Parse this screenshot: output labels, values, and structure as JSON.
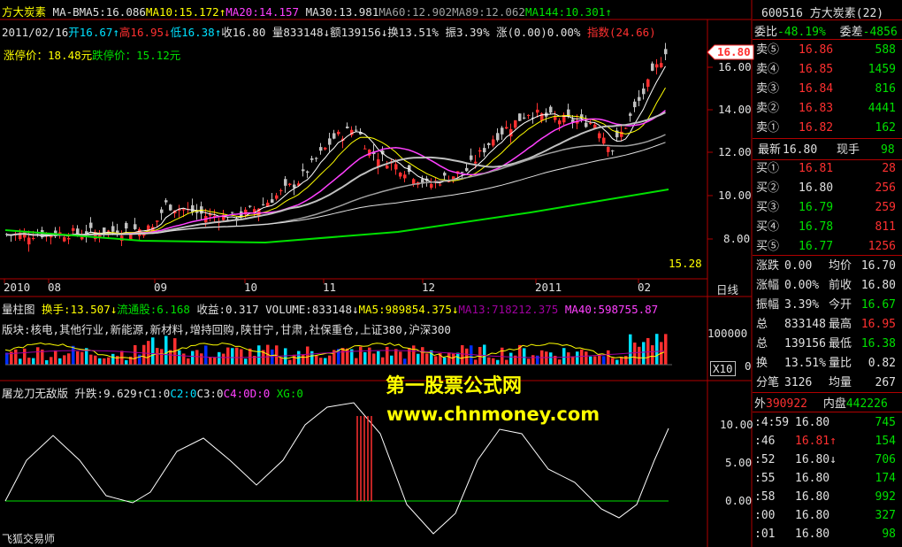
{
  "header": {
    "stock_name": "方大炭素",
    "indicator": "MA-B",
    "ma5": "MA5:16.086",
    "ma10": "MA10:15.172↑",
    "ma20": "MA20:14.157",
    "ma30": "MA30:13.981",
    "ma60": "MA60:12.902",
    "ma89": "MA89:12.062",
    "ma144": "MA144:10.301↑"
  },
  "info": {
    "date": "2011/02/16",
    "open": "开16.67↑",
    "high": "高16.95↓",
    "low": "低16.38↑",
    "close": "收16.80",
    "volume": "量833148↓",
    "amount": "额139156↓",
    "turnover": "换13.51%",
    "amplitude": "振3.39%",
    "change": "涨(0.00)0.00%",
    "index": "指数(24.66)"
  },
  "limits": {
    "up": "涨停价：18.48元",
    "down": "跌停价：15.12元"
  },
  "price_axis": [
    "16.00",
    "14.00",
    "12.00",
    "10.00",
    "8.00"
  ],
  "price_tag": "16.80",
  "low_label": "15.28",
  "time_axis": [
    "2010",
    "08",
    "09",
    "10",
    "11",
    "12",
    "2011",
    "02"
  ],
  "period_button": "日线",
  "vol_header": {
    "title": "量柱图",
    "turnover": "换手:13.507↓",
    "float": "流通股:6.168",
    "income": "收益:0.317",
    "volume": "VOLUME:833148↓",
    "ma5": "MA5:989854.375↓",
    "ma13": "MA13:718212.375",
    "ma40": "MA40:598755.87"
  },
  "sectors": "版块:核电,其他行业,新能源,新材料,增持回购,陕甘宁,甘肃,社保重仓,上证380,沪深300",
  "vol_axis": [
    "100000",
    "0"
  ],
  "vol_unit": "X10",
  "indicator_panel": {
    "title": "屠龙刀无敌版",
    "values": "升跌:9.629↑C1:0",
    "c2": "C2:0",
    "c3": "C3:0",
    "c4": "C4:0",
    "d": "D:0",
    "xg": "XG:0",
    "axis": [
      "10.00",
      "5.00",
      "0.00"
    ]
  },
  "watermark": {
    "line1": "第一股票公式网",
    "line2": "www.chnmoney.com"
  },
  "footer_label": "飞狐交易师",
  "quote": {
    "code_name": "600516 方大炭素",
    "num": "(22)",
    "weibi_label": "委比",
    "weibi": "-48.19%",
    "weicha_label": "委差",
    "weicha": "-4856",
    "asks": [
      {
        "label": "卖⑤",
        "price": "16.86",
        "vol": "588"
      },
      {
        "label": "卖④",
        "price": "16.85",
        "vol": "1459"
      },
      {
        "label": "卖③",
        "price": "16.84",
        "vol": "816"
      },
      {
        "label": "卖②",
        "price": "16.83",
        "vol": "4441"
      },
      {
        "label": "卖①",
        "price": "16.82",
        "vol": "162"
      }
    ],
    "latest_label": "最新",
    "latest": "16.80",
    "xianshou_label": "现手",
    "xianshou": "98",
    "bids": [
      {
        "label": "买①",
        "price": "16.81",
        "vol": "28"
      },
      {
        "label": "买②",
        "price": "16.80",
        "vol": "256"
      },
      {
        "label": "买③",
        "price": "16.79",
        "vol": "259"
      },
      {
        "label": "买④",
        "price": "16.78",
        "vol": "811"
      },
      {
        "label": "买⑤",
        "price": "16.77",
        "vol": "1256"
      }
    ],
    "stats": [
      {
        "l1": "涨跌",
        "v1": "0.00",
        "l2": "均价",
        "v2": "16.70"
      },
      {
        "l1": "涨幅",
        "v1": "0.00%",
        "l2": "前收",
        "v2": "16.80"
      },
      {
        "l1": "振幅",
        "v1": "3.39%",
        "l2": "今开",
        "v2": "16.67"
      },
      {
        "l1": "总",
        "v1": "833148",
        "l2": "最高",
        "v2": "16.95"
      },
      {
        "l1": "总",
        "v1": "139156",
        "l2": "最低",
        "v2": "16.38"
      },
      {
        "l1": "换",
        "v1": "13.51%",
        "l2": "量比",
        "v2": "0.82"
      },
      {
        "l1": "分笔",
        "v1": "3126",
        "l2": "均量",
        "v2": "267"
      }
    ],
    "outer_label": "外",
    "outer": "390922",
    "inner_label": "内盘",
    "inner": "442226",
    "ticks": [
      {
        "t": ":4:59",
        "p": "16.80",
        "v": "745"
      },
      {
        "t": ":46",
        "p": "16.81↑",
        "v": "154"
      },
      {
        "t": ":52",
        "p": "16.80↓",
        "v": "706"
      },
      {
        "t": ":55",
        "p": "16.80",
        "v": "174"
      },
      {
        "t": ":58",
        "p": "16.80",
        "v": "992"
      },
      {
        "t": ":00",
        "p": "16.80",
        "v": "327"
      },
      {
        "t": ":01",
        "p": "16.80",
        "v": "98"
      }
    ]
  },
  "colors": {
    "up": "#ff3030",
    "down": "#00e0ff",
    "grid": "#b00000",
    "ma5": "#ffffff",
    "ma10": "#ffff00",
    "ma20": "#ff40ff",
    "ma30": "#c0c0c0",
    "ma144": "#00e000"
  }
}
